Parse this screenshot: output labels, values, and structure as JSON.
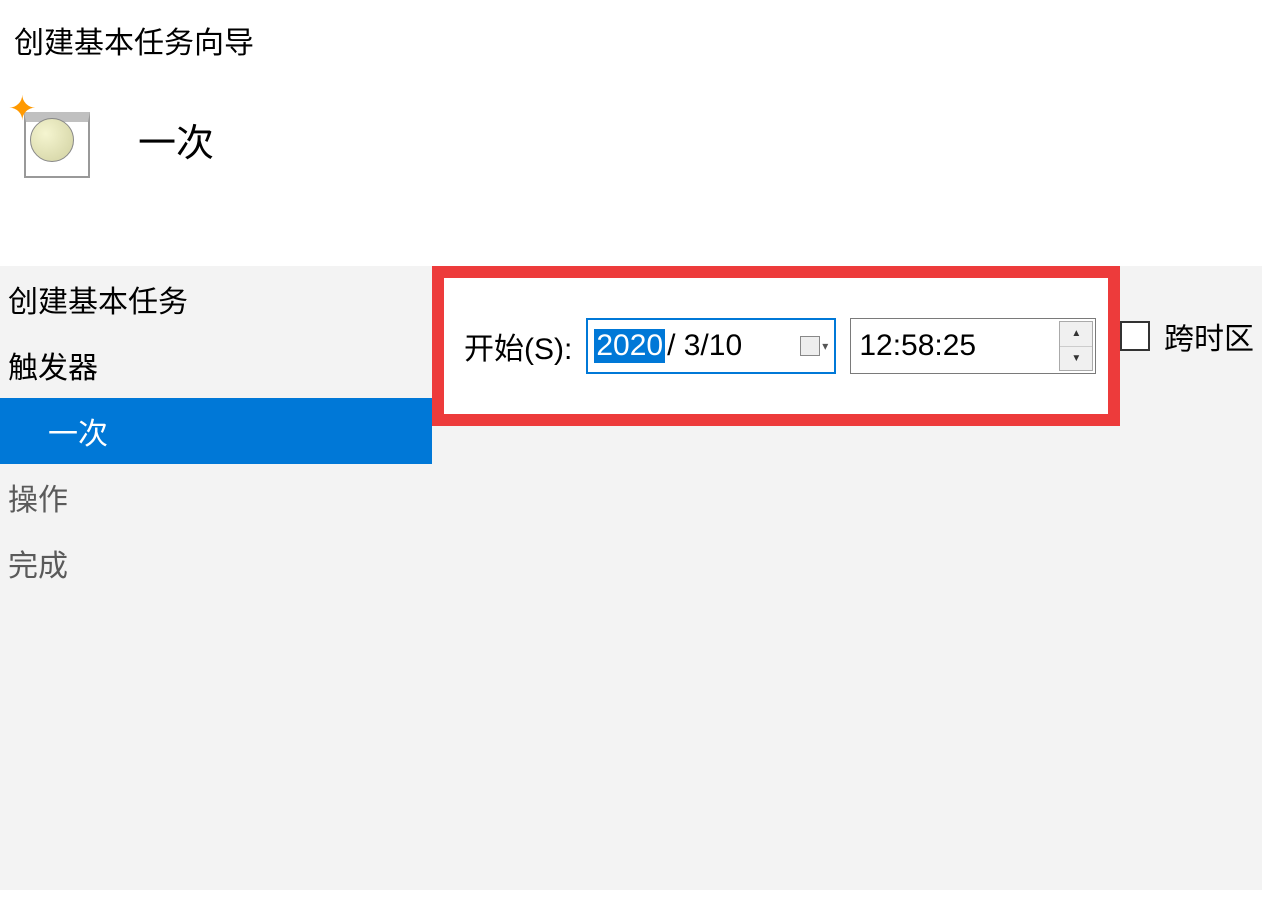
{
  "window": {
    "title": "创建基本任务向导"
  },
  "header": {
    "page_title": "一次"
  },
  "sidebar": {
    "items": [
      {
        "label": "创建基本任务"
      },
      {
        "label": "触发器"
      },
      {
        "label": "一次"
      },
      {
        "label": "操作"
      },
      {
        "label": "完成"
      }
    ]
  },
  "content": {
    "start_label": "开始(S):",
    "date": {
      "year": "2020",
      "rest": "/ 3/10"
    },
    "time": "12:58:25",
    "timezone_label": "跨时区"
  }
}
